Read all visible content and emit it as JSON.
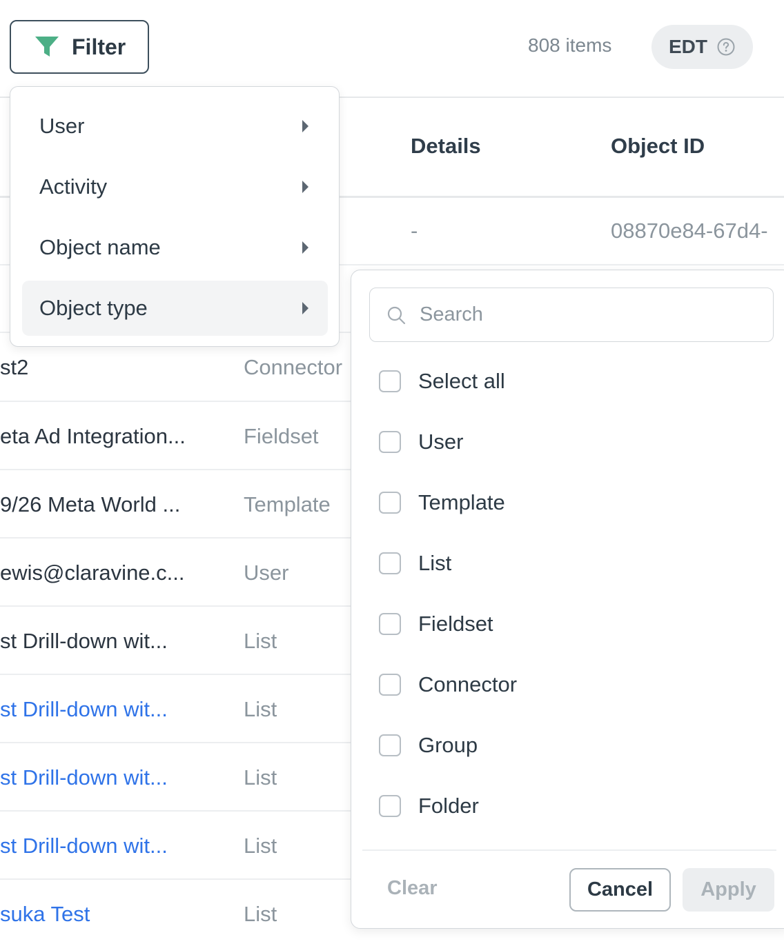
{
  "toolbar": {
    "filter_label": "Filter",
    "items_count": "808 items",
    "timezone": "EDT"
  },
  "table": {
    "columns": {
      "details": "Details",
      "object_id": "Object ID"
    },
    "rows": [
      {
        "name": "",
        "type": "",
        "details": "-",
        "object_id": "08870e84-67d4-"
      },
      {
        "name": "",
        "type": "",
        "details": "",
        "object_id": ""
      },
      {
        "name": "st2",
        "type": "Connector",
        "details": "",
        "object_id": ""
      },
      {
        "name": "eta Ad Integration...",
        "type": "Fieldset",
        "details": "",
        "object_id": ""
      },
      {
        "name": "9/26 Meta World ...",
        "type": "Template",
        "details": "",
        "object_id": ""
      },
      {
        "name": "ewis@claravine.c...",
        "type": "User",
        "details": "",
        "object_id": ""
      },
      {
        "name": "st Drill-down wit...",
        "type": "List",
        "details": "",
        "object_id": ""
      },
      {
        "name": "st Drill-down wit...",
        "type": "List",
        "details": "",
        "object_id": ""
      },
      {
        "name": "st Drill-down wit...",
        "type": "List",
        "details": "",
        "object_id": ""
      },
      {
        "name": "st Drill-down wit...",
        "type": "List",
        "details": "",
        "object_id": ""
      },
      {
        "name": "suka Test",
        "type": "List",
        "details": "",
        "object_id": ""
      }
    ]
  },
  "filter_menu": {
    "categories": [
      {
        "label": "User"
      },
      {
        "label": "Activity"
      },
      {
        "label": "Object name"
      },
      {
        "label": "Object type"
      }
    ],
    "active_category": "Object type"
  },
  "options_panel": {
    "search_placeholder": "Search",
    "options": [
      {
        "label": "Select all",
        "checked": false
      },
      {
        "label": "User",
        "checked": false
      },
      {
        "label": "Template",
        "checked": false
      },
      {
        "label": "List",
        "checked": false
      },
      {
        "label": "Fieldset",
        "checked": false
      },
      {
        "label": "Connector",
        "checked": false
      },
      {
        "label": "Group",
        "checked": false
      },
      {
        "label": "Folder",
        "checked": false
      }
    ],
    "clear_label": "Clear",
    "cancel_label": "Cancel",
    "apply_label": "Apply"
  },
  "colors": {
    "accent_filter_icon": "#4caf86",
    "link": "#2f73e8"
  },
  "icons": [
    "filter-icon",
    "help-circle-icon",
    "caret-right-icon",
    "search-icon"
  ]
}
